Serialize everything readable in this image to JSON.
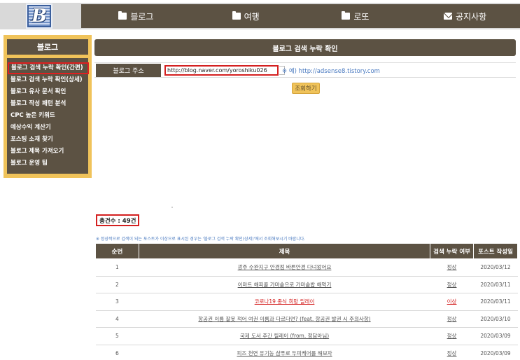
{
  "logo": {
    "letter": "B"
  },
  "nav": {
    "items": [
      {
        "label": "블로그",
        "icon": "folder-icon"
      },
      {
        "label": "여행",
        "icon": "folder-icon"
      },
      {
        "label": "로또",
        "icon": "folder-icon"
      },
      {
        "label": "공지사항",
        "icon": "mail-icon"
      }
    ]
  },
  "sidebar": {
    "title": "블로그",
    "items": [
      {
        "label": "블로그 검색 누락 확인(간편)"
      },
      {
        "label": "블로그 검색 누락 확인(상세)"
      },
      {
        "label": "블로그 유사 문서 확인"
      },
      {
        "label": "블로그 작성 패턴 분석"
      },
      {
        "label": "CPC 높은 키워드"
      },
      {
        "label": "예상수익 계산기"
      },
      {
        "label": "포스팅 소재 찾기"
      },
      {
        "label": "블로그 제목 가져오기"
      },
      {
        "label": "블로그 운영 팁"
      }
    ]
  },
  "main": {
    "title": "블로그 검색 누락 확인",
    "form": {
      "label": "블로그 주소",
      "value": "http://blog.naver.com/yoroshiku026",
      "hint": "※ 예) http://adsense8.tistory.com"
    },
    "search_button": "조회하기",
    "total": "총건수 : 49건",
    "note": "※ 정상적으로 검색이 되는 포스트가 이상으로 표시된 경우는 '블로그 검색 누락 확인(상세)'에서 조회해보시기 바랍니다.",
    "table": {
      "headers": [
        "순번",
        "제목",
        "검색 누락 여부",
        "포스트 작성일"
      ],
      "rows": [
        {
          "num": "1",
          "title": "광주 수완지구 안경점 바른안경 다녀왔어요",
          "status": "정상",
          "date": "2020/03/12",
          "flag": false
        },
        {
          "num": "2",
          "title": "이마트 해피콜 가마솥으로 가마솥밥 해먹기",
          "status": "정상",
          "date": "2020/03/11",
          "flag": false
        },
        {
          "num": "3",
          "title": "코로나19 종식 희망 릴레이",
          "status": "이상",
          "date": "2020/03/11",
          "flag": true
        },
        {
          "num": "4",
          "title": "항공권 이름 잘못 적어 여권 이름과 다르다면? (feat. 항공권 발권 시 주의사항)",
          "status": "정상",
          "date": "2020/03/10",
          "flag": false
        },
        {
          "num": "5",
          "title": "국제 도서 주간 릴레이 (from. 정담아님)",
          "status": "정상",
          "date": "2020/03/09",
          "flag": false
        },
        {
          "num": "6",
          "title": "피즈 천연 유기농 샴푸로 두피케어를 해보자",
          "status": "정상",
          "date": "2020/03/09",
          "flag": false
        }
      ]
    }
  },
  "colors": {
    "brown": "#5c5243",
    "gold": "#f0c35a",
    "highlight_red": "#d42020",
    "link_blue": "#4a7ac0"
  }
}
